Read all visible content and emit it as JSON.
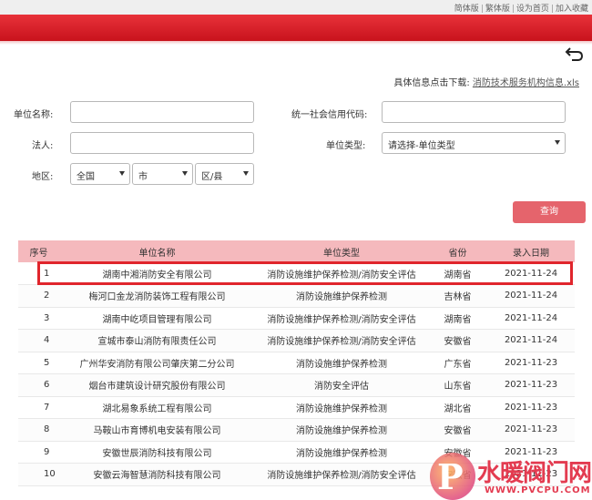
{
  "toplinks": [
    "简体版",
    "繁体版",
    "设为首页",
    "加入收藏"
  ],
  "download": {
    "label": "具体信息点击下载:",
    "link": "消防技术服务机构信息.xls"
  },
  "form": {
    "unit_name_label": "单位名称:",
    "credit_code_label": "统一社会信用代码:",
    "legal_person_label": "法人:",
    "unit_type_label": "单位类型:",
    "unit_type_value": "请选择-单位类型",
    "region_label": "地区:",
    "region_country": "全国",
    "region_city": "市",
    "region_district": "区/县",
    "query_button": "查询"
  },
  "table": {
    "headers": [
      "序号",
      "单位名称",
      "单位类型",
      "省份",
      "录入日期"
    ],
    "rows": [
      [
        "1",
        "湖南中湘消防安全有限公司",
        "消防设施维护保养检测/消防安全评估",
        "湖南省",
        "2021-11-24"
      ],
      [
        "2",
        "梅河口金龙消防装饰工程有限公司",
        "消防设施维护保养检测",
        "吉林省",
        "2021-11-24"
      ],
      [
        "3",
        "湖南中屹项目管理有限公司",
        "消防设施维护保养检测/消防安全评估",
        "湖南省",
        "2021-11-24"
      ],
      [
        "4",
        "宣城市泰山消防有限责任公司",
        "消防设施维护保养检测/消防安全评估",
        "安徽省",
        "2021-11-24"
      ],
      [
        "5",
        "广州华安消防有限公司肇庆第二分公司",
        "消防设施维护保养检测",
        "广东省",
        "2021-11-23"
      ],
      [
        "6",
        "烟台市建筑设计研究股份有限公司",
        "消防安全评估",
        "山东省",
        "2021-11-23"
      ],
      [
        "7",
        "湖北易象系统工程有限公司",
        "消防设施维护保养检测",
        "湖北省",
        "2021-11-23"
      ],
      [
        "8",
        "马鞍山市育博机电安装有限公司",
        "消防设施维护保养检测",
        "安徽省",
        "2021-11-23"
      ],
      [
        "9",
        "安徽世辰消防科技有限公司",
        "消防设施维护保养检测",
        "安徽省",
        "2021-11-23"
      ],
      [
        "10",
        "安徽云海智慧消防科技有限公司",
        "消防设施维护保养检测/消防安全评估",
        "安徽省",
        "2021-11-23"
      ]
    ]
  },
  "watermark": {
    "text": "水暖阀门网",
    "url": "WWW.PVCPU.COM",
    "logo_letter": "P"
  },
  "colors": {
    "brand_red": "#d81e26",
    "header_row": "#f5b9bd",
    "query_button": "#e5646c",
    "highlight": "#e0252c"
  }
}
